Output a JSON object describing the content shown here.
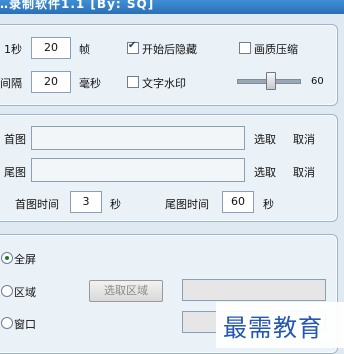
{
  "window": {
    "title": "…录制软件1.1 [By: SQ]"
  },
  "settings": {
    "fps_label": "1秒",
    "fps_value": "20",
    "fps_unit": "帧",
    "interval_label": "间隔",
    "interval_value": "20",
    "interval_unit": "毫秒",
    "hide_after_start_label": "开始后隐藏",
    "hide_after_start_checked": true,
    "compress_label": "画质压缩",
    "compress_checked": false,
    "text_watermark_label": "文字水印",
    "text_watermark_checked": false,
    "quality_value": "60",
    "quality_fraction": 0.55
  },
  "images": {
    "first_label": "首图",
    "last_label": "尾图",
    "select_label": "选取",
    "cancel_label": "取消",
    "first_time_label": "首图时间",
    "first_time_value": "3",
    "last_time_label": "尾图时间",
    "last_time_value": "60",
    "seconds_unit": "秒"
  },
  "capture": {
    "fullscreen_label": "全屏",
    "region_label": "区域",
    "window_label": "窗口",
    "select_region_button": "选取区域",
    "selected_mode": "fullscreen"
  },
  "watermark_text": "最需教育"
}
